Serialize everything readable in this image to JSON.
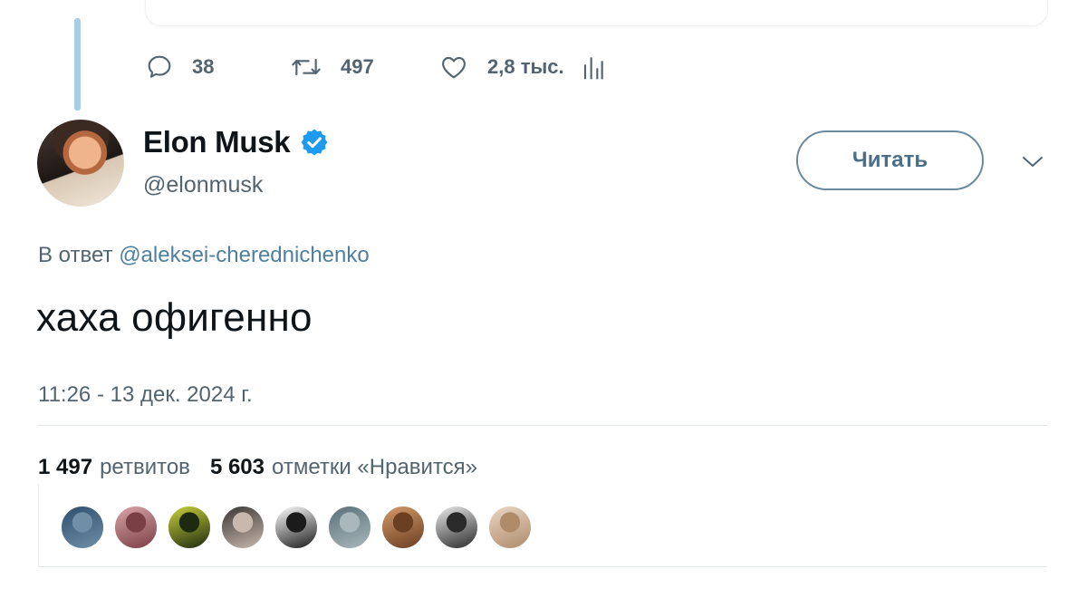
{
  "parent_tweet": {
    "actions": {
      "replies": "38",
      "retweets": "497",
      "likes": "2,8 тыс."
    }
  },
  "tweet": {
    "author": {
      "display_name": "Elon Musk",
      "handle": "@elonmusk",
      "verified": true
    },
    "follow_label": "Читать",
    "reply_prefix": "В ответ",
    "reply_to": "@aleksei-cherednichenko",
    "text": "хаха офигенно",
    "timestamp": "11:26 - 13 дек. 2024 г.",
    "stats": {
      "retweets_count": "1 497",
      "retweets_label": "ретвитов",
      "likes_count": "5 603",
      "likes_label": "отметки «Нравится»"
    },
    "likers": [
      {
        "color": "#2d4e6e",
        "color2": "#6f8ea8"
      },
      {
        "color": "#d9a4a8",
        "color2": "#7a3f45"
      },
      {
        "color": "#c9d23a",
        "color2": "#1e2a10"
      },
      {
        "color": "#3c3534",
        "color2": "#c7b9ae"
      },
      {
        "color": "#ffffff",
        "color2": "#1b1b1b"
      },
      {
        "color": "#5a7077",
        "color2": "#a8b8bc"
      },
      {
        "color": "#d29a6a",
        "color2": "#6b3f22"
      },
      {
        "color": "#e9e9e9",
        "color2": "#2a2a2a"
      },
      {
        "color": "#e8d7c5",
        "color2": "#b08b6a"
      }
    ]
  },
  "colors": {
    "accent": "#1d9bf0",
    "muted": "#536471",
    "mention": "#4f7f9e",
    "thread_line": "#a9cde6"
  },
  "icons": {
    "reply": "comment-bubble-icon",
    "retweet": "retweet-icon",
    "like": "heart-icon",
    "stats": "analytics-bars-icon",
    "verified": "verified-badge-icon",
    "more": "chevron-down-icon"
  }
}
